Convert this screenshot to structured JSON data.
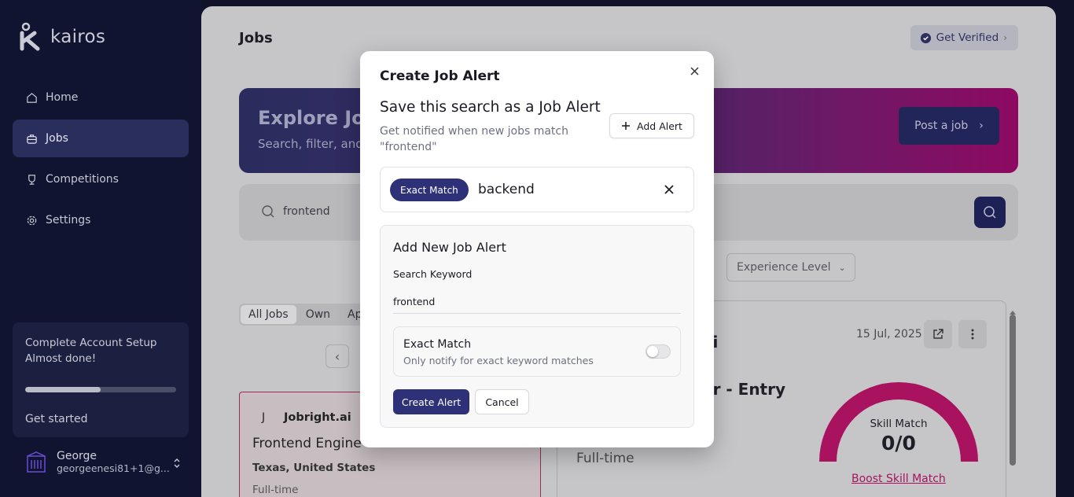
{
  "brand": {
    "name": "kairos"
  },
  "sidebar": {
    "items": [
      {
        "label": "Home",
        "icon": "home-icon"
      },
      {
        "label": "Jobs",
        "icon": "briefcase-icon",
        "active": true
      },
      {
        "label": "Competitions",
        "icon": "trophy-icon"
      },
      {
        "label": "Settings",
        "icon": "gear-icon"
      }
    ],
    "setup": {
      "title": "Complete Account Setup",
      "subtitle": "Almost done!",
      "progress": 0.5,
      "link": "Get started"
    },
    "user": {
      "name": "George",
      "email": "georgeenesi81+1@g..."
    }
  },
  "header": {
    "title": "Jobs",
    "verified_label": "Get Verified"
  },
  "banner": {
    "title": "Explore Job",
    "subtitle": "Search, filter, and",
    "post_label": "Post a job"
  },
  "search": {
    "value": "frontend"
  },
  "filters": {
    "experience_label": "Experience Level"
  },
  "tabs": [
    "All Jobs",
    "Own",
    "Ap"
  ],
  "job_card": {
    "logo_letter": "J",
    "company": "Jobright.ai",
    "title": "Frontend Engine",
    "location": "Texas, United States",
    "type": "Full-time"
  },
  "detail": {
    "company_tail": "ai",
    "date": "15 Jul, 2025",
    "title_tail": "er - Entry",
    "type": "Full-time",
    "skill_label": "Skill Match",
    "skill_value": "0/0",
    "boost_label": "Boost Skill Match"
  },
  "modal": {
    "title": "Create Job Alert",
    "heading": "Save this search as a Job Alert",
    "description": "Get notified when new jobs match \"frontend\"",
    "add_alert_label": "Add Alert",
    "existing_alert": {
      "match_label": "Exact Match",
      "keyword": "backend"
    },
    "new_alert": {
      "title": "Add New Job Alert",
      "keyword_label": "Search Keyword",
      "keyword_value": "frontend",
      "exact_title": "Exact Match",
      "exact_subtitle": "Only notify for exact keyword matches",
      "exact_enabled": false,
      "create_label": "Create Alert",
      "cancel_label": "Cancel"
    }
  },
  "colors": {
    "primary": "#2e3178",
    "accent": "#a8125e",
    "sidebar": "#111430"
  }
}
